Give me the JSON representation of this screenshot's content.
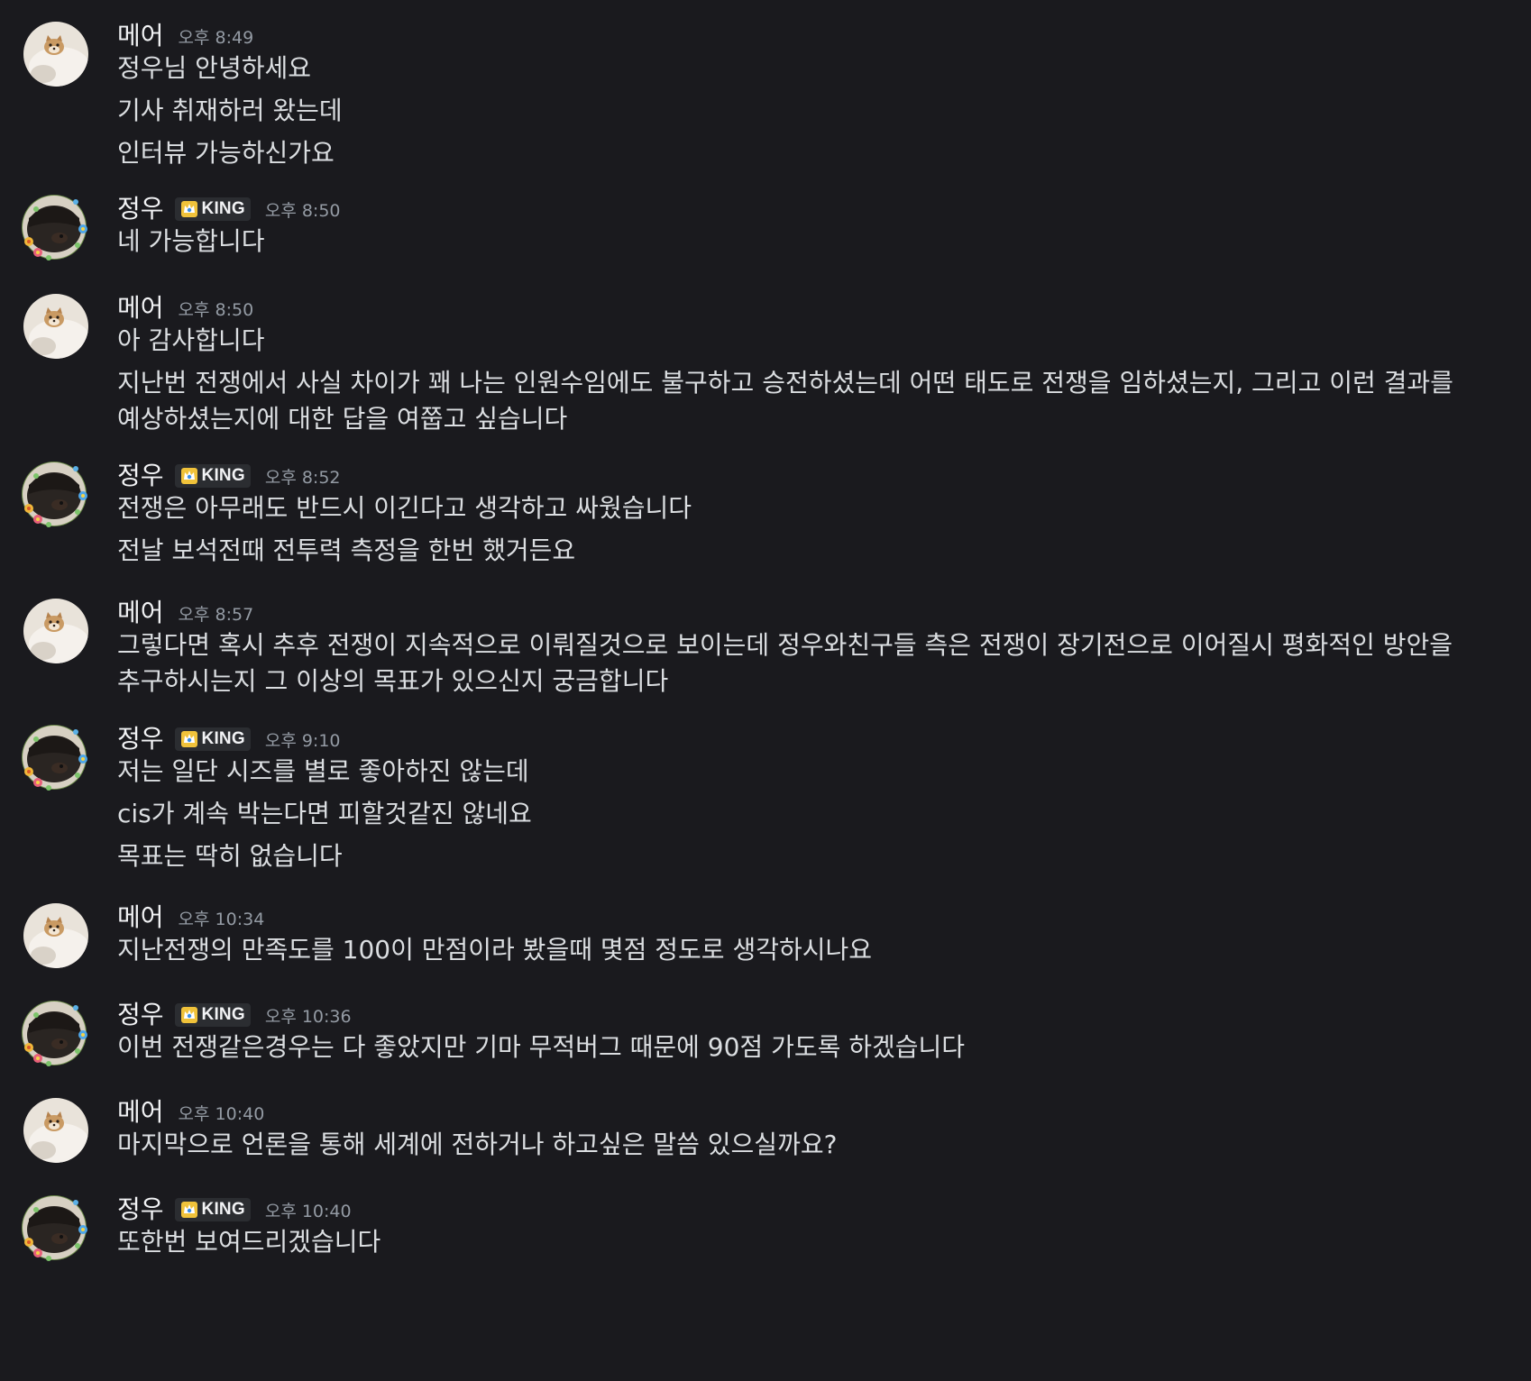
{
  "badge_label": "KING",
  "colors": {
    "background": "#1a1a1e",
    "text": "#dbdee1",
    "username": "#f2f3f5",
    "timestamp": "#949ba4",
    "badge_bg": "#2b2d31"
  },
  "messages": [
    {
      "author": "메어",
      "time": "오후 8:49",
      "badge": false,
      "avatar": "dog-plush-avatar",
      "lines": [
        "정우님 안녕하세요",
        "기사 취재하러 왔는데",
        "인터뷰 가능하신가요"
      ]
    },
    {
      "author": "정우",
      "time": "오후 8:50",
      "badge": true,
      "avatar": "dark-dog-flowers-avatar",
      "lines": [
        "네 가능합니다"
      ]
    },
    {
      "author": "메어",
      "time": "오후 8:50",
      "badge": false,
      "avatar": "dog-plush-avatar",
      "lines": [
        "아 감사합니다",
        "지난번 전쟁에서 사실 차이가 꽤 나는 인원수임에도 불구하고 승전하셨는데 어떤 태도로 전쟁을 임하셨는지, 그리고 이런 결과를 예상하셨는지에 대한 답을 여쭙고 싶습니다"
      ]
    },
    {
      "author": "정우",
      "time": "오후 8:52",
      "badge": true,
      "avatar": "dark-dog-flowers-avatar",
      "lines": [
        "전쟁은 아무래도 반드시 이긴다고 생각하고 싸웠습니다",
        "전날 보석전때 전투력 측정을 한번 했거든요"
      ]
    },
    {
      "author": "메어",
      "time": "오후 8:57",
      "badge": false,
      "avatar": "dog-plush-avatar",
      "lines": [
        "그렇다면 혹시 추후 전쟁이 지속적으로 이뤄질것으로 보이는데 정우와친구들 측은 전쟁이 장기전으로 이어질시 평화적인 방안을 추구하시는지 그 이상의 목표가 있으신지 궁금합니다"
      ]
    },
    {
      "author": "정우",
      "time": "오후 9:10",
      "badge": true,
      "avatar": "dark-dog-flowers-avatar",
      "lines": [
        "저는 일단 시즈를 별로 좋아하진 않는데",
        "cis가 계속 박는다면 피할것같진 않네요",
        "목표는 딱히 없습니다"
      ]
    },
    {
      "author": "메어",
      "time": "오후 10:34",
      "badge": false,
      "avatar": "dog-plush-avatar",
      "lines": [
        "지난전쟁의 만족도를 100이 만점이라 봤을때 몇점 정도로 생각하시나요"
      ]
    },
    {
      "author": "정우",
      "time": "오후 10:36",
      "badge": true,
      "avatar": "dark-dog-flowers-avatar",
      "lines": [
        "이번 전쟁같은경우는 다 좋았지만 기마 무적버그 때문에 90점 가도록 하겠습니다"
      ]
    },
    {
      "author": "메어",
      "time": "오후 10:40",
      "badge": false,
      "avatar": "dog-plush-avatar",
      "lines": [
        "마지막으로 언론을 통해 세계에 전하거나 하고싶은 말씀 있으실까요?"
      ]
    },
    {
      "author": "정우",
      "time": "오후 10:40",
      "badge": true,
      "avatar": "dark-dog-flowers-avatar",
      "lines": [
        "또한번 보여드리겠습니다"
      ]
    }
  ]
}
